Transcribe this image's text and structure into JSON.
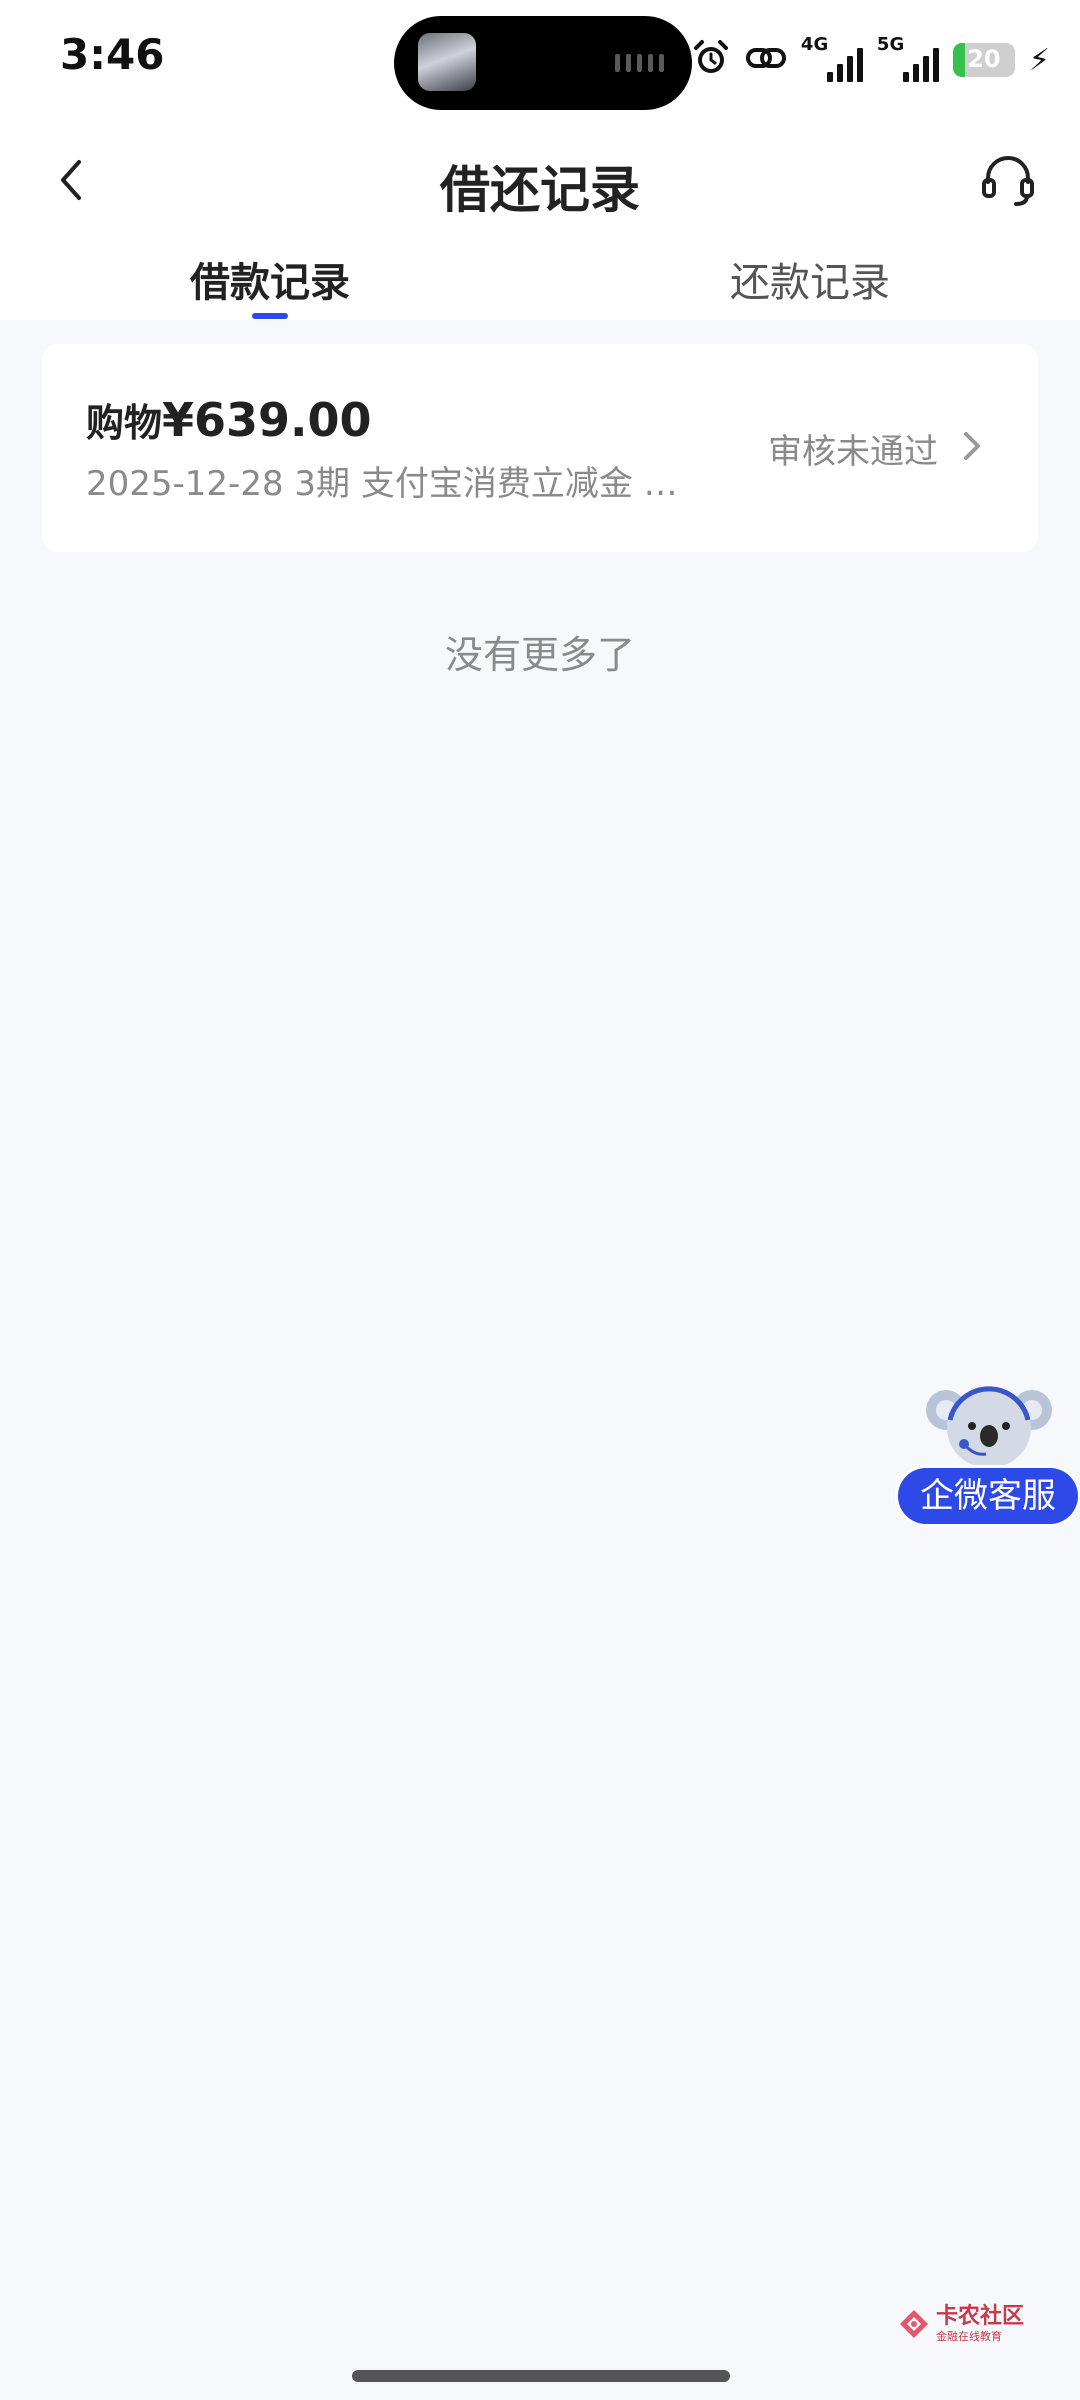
{
  "status_bar": {
    "time": "3:46",
    "network_4g_label": "4G",
    "network_5g_label": "5G",
    "battery_percent": "20"
  },
  "header": {
    "title": "借还记录",
    "tabs": [
      {
        "label": "借款记录",
        "active": true
      },
      {
        "label": "还款记录",
        "active": false
      }
    ]
  },
  "records": [
    {
      "type": "购物",
      "amount": "¥639.00",
      "meta": "2025-12-28 3期  支付宝消费立减金 …",
      "status": "审核未通过"
    }
  ],
  "footer_text": "没有更多了",
  "floating_service": {
    "label": "企微客服"
  },
  "watermark": {
    "name": "卡农社区",
    "tagline": "金融在线教育"
  },
  "colors": {
    "accent": "#2d49e8",
    "background": "#f7f8fc",
    "battery": "#35c24a",
    "muted_text": "#8a8a8a"
  }
}
